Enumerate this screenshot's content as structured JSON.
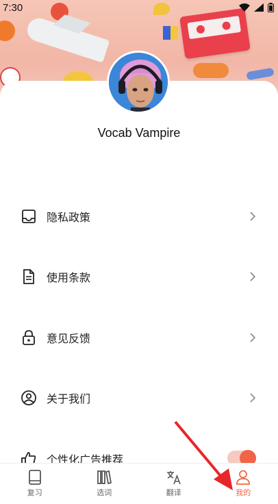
{
  "status_bar": {
    "time": "7:30"
  },
  "profile": {
    "username": "Vocab Vampire"
  },
  "menu": [
    {
      "label": "隐私政策",
      "icon": "inbox-icon"
    },
    {
      "label": "使用条款",
      "icon": "document-icon"
    },
    {
      "label": "意见反馈",
      "icon": "lock-icon"
    },
    {
      "label": "关于我们",
      "icon": "user-circle-icon"
    },
    {
      "label": "个性化广告推荐",
      "icon": "thumbs-up-icon"
    }
  ],
  "ad_toggle": {
    "on": true
  },
  "bottom_nav": [
    {
      "label": "复习",
      "icon": "book-icon",
      "active": false
    },
    {
      "label": "选词",
      "icon": "library-icon",
      "active": false
    },
    {
      "label": "翻译",
      "icon": "translate-icon",
      "active": false
    },
    {
      "label": "我的",
      "icon": "person-icon",
      "active": true
    }
  ],
  "colors": {
    "accent": "#f06547",
    "banner": "#f2b6a6",
    "annotation_arrow": "#e8252a"
  }
}
